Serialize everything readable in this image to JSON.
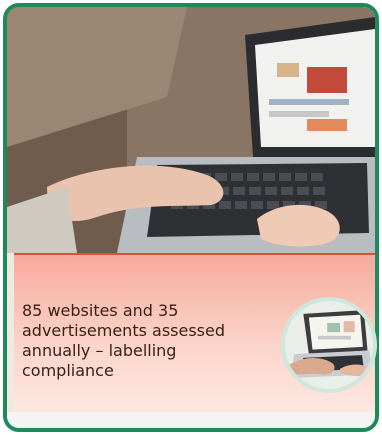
{
  "card": {
    "photo": {
      "icon": "laptop-shopping-photo"
    },
    "caption": "85 websites and 35 advertisements assessed annually – labelling compliance",
    "inset": {
      "icon": "laptop-hands-photo"
    }
  },
  "colors": {
    "border_green": "#1e8a5c",
    "panel_border": "#d9513a",
    "panel_top": "#f7a99c",
    "panel_bottom": "#fde8e1"
  }
}
